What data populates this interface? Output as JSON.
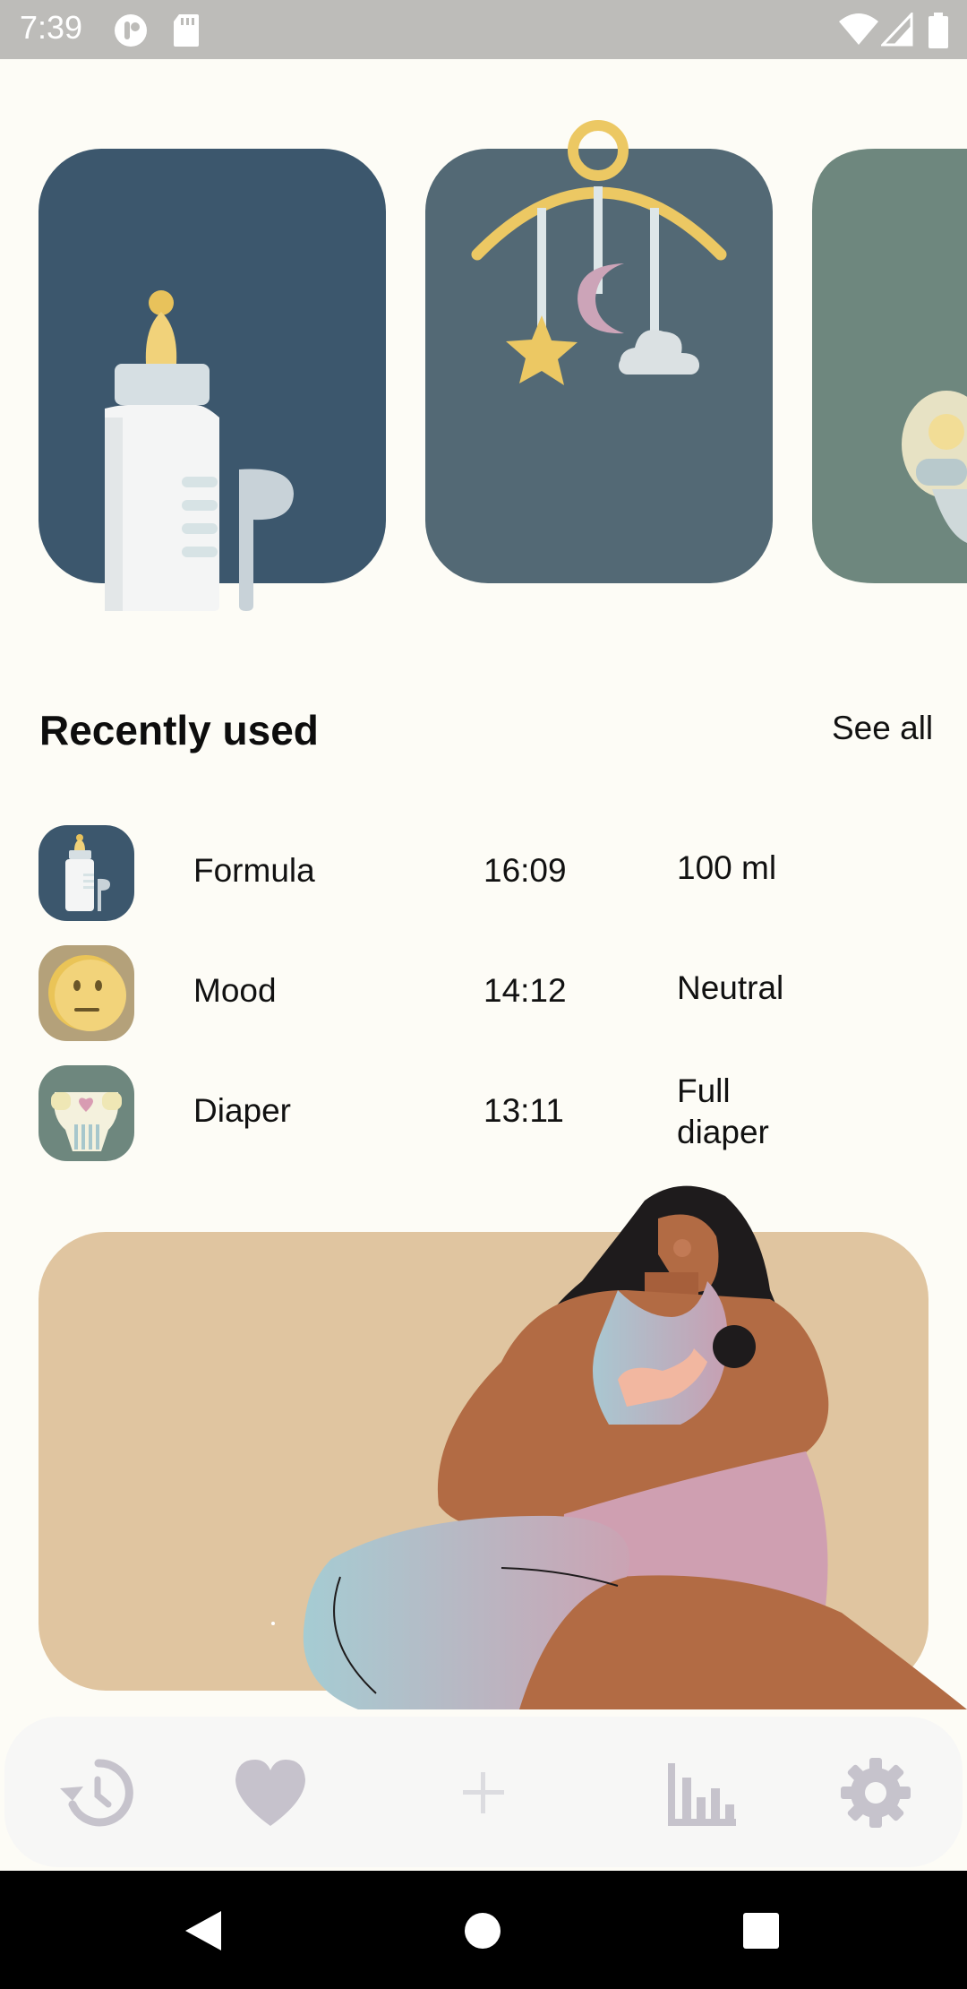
{
  "status_bar": {
    "time": "7:39",
    "icons": [
      "app-notification-icon",
      "sd-card-icon",
      "wifi-icon",
      "signal-icon",
      "battery-icon"
    ]
  },
  "feature_cards": [
    {
      "icon": "baby-bottle-illustration",
      "color": "#3c576d"
    },
    {
      "icon": "crib-mobile-illustration",
      "color": "#536975"
    },
    {
      "icon": "diaper-illustration",
      "color": "#6e877e"
    }
  ],
  "recent": {
    "title": "Recently used",
    "see_all": "See all",
    "items": [
      {
        "name": "Formula",
        "time": "16:09",
        "value": "100 ml",
        "icon": "baby-bottle-icon",
        "color": "#3c576d"
      },
      {
        "name": "Mood",
        "time": "14:12",
        "value": "Neutral",
        "icon": "neutral-face-icon",
        "color": "#b4a17a"
      },
      {
        "name": "Diaper",
        "time": "13:11",
        "value": "Full diaper",
        "icon": "diaper-icon",
        "color": "#6e877e"
      }
    ]
  },
  "bottom_nav": {
    "items": [
      "history-icon",
      "heart-icon",
      "add-icon",
      "bar-chart-icon",
      "settings-icon"
    ]
  },
  "system_nav": [
    "back-icon",
    "home-icon",
    "recents-icon"
  ]
}
